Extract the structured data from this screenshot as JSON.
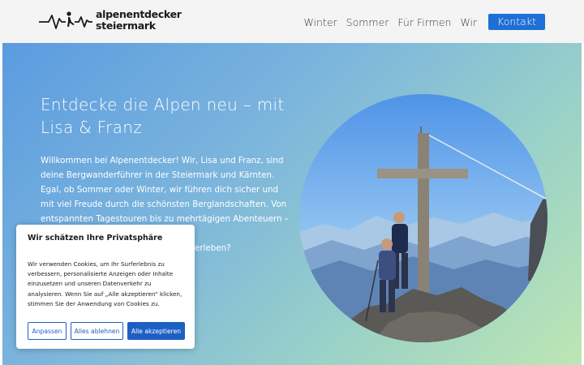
{
  "header": {
    "logo": {
      "line1": "alpenentdecker",
      "line2": "steiermark",
      "icon": "heartbeat-hiker-icon"
    },
    "nav": [
      "Winter",
      "Sommer",
      "Für Firmen",
      "Wir"
    ],
    "cta": "Kontakt"
  },
  "hero": {
    "title": "Entdecke die Alpen neu – mit Lisa & Franz",
    "text_visible": "Willkommen bei Alpenentdecker! Wir, Lisa und Franz, sind deine Bergwanderführer in der Steiermark und Kärnten. Egal, ob Sommer oder Winter, wir führen dich sicher und mit viel Freude durch die schönsten Berglandschaften. Von entspannten Tagestouren bis zu mehrtägigen Abenteuern –",
    "text_tail_visible": "erleben?",
    "photo": "summit-cross-hikers-photo"
  },
  "cookie": {
    "title": "Wir schätzen Ihre Privatsphäre",
    "text": "Wir verwenden Cookies, um Ihr Surferlebnis zu verbessern, personalisierte Anzeigen oder Inhalte einzusetzen und unseren Datenverkehr zu analysieren. Wenn Sie auf „Alle akzeptieren“ klicken, stimmen Sie der Anwendung von Cookies zu.",
    "buttons": {
      "customize": "Anpassen",
      "reject": "Alles ablehnen",
      "accept": "Alle akzeptieren"
    }
  },
  "colors": {
    "accent": "#1e6fd6",
    "cookie_button": "#1e5fc4",
    "hero_start": "#5b9be0",
    "hero_end": "#bde6b3"
  }
}
